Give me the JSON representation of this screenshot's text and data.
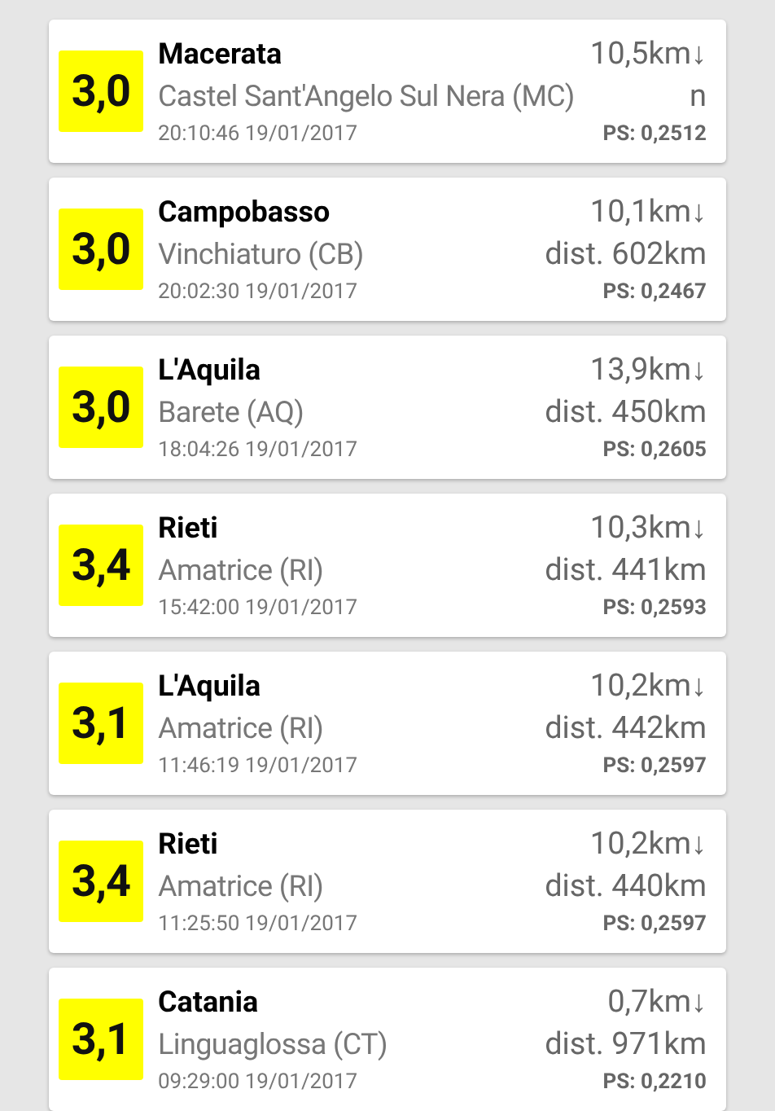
{
  "quakes": [
    {
      "magnitude": "3,0",
      "province": "Macerata",
      "place": "Castel Sant'Angelo Sul Nera (MC)",
      "depth": "10,5km↓",
      "distance": "n",
      "time": "20:10:46 19/01/2017",
      "ps": "PS: 0,2512"
    },
    {
      "magnitude": "3,0",
      "province": "Campobasso",
      "place": "Vinchiaturo (CB)",
      "depth": "10,1km↓",
      "distance": "dist. 602km",
      "time": "20:02:30 19/01/2017",
      "ps": "PS: 0,2467"
    },
    {
      "magnitude": "3,0",
      "province": "L'Aquila",
      "place": "Barete (AQ)",
      "depth": "13,9km↓",
      "distance": "dist. 450km",
      "time": "18:04:26 19/01/2017",
      "ps": "PS: 0,2605"
    },
    {
      "magnitude": "3,4",
      "province": "Rieti",
      "place": "Amatrice (RI)",
      "depth": "10,3km↓",
      "distance": "dist. 441km",
      "time": "15:42:00 19/01/2017",
      "ps": "PS: 0,2593"
    },
    {
      "magnitude": "3,1",
      "province": "L'Aquila",
      "place": "Amatrice (RI)",
      "depth": "10,2km↓",
      "distance": "dist. 442km",
      "time": "11:46:19 19/01/2017",
      "ps": "PS: 0,2597"
    },
    {
      "magnitude": "3,4",
      "province": "Rieti",
      "place": "Amatrice (RI)",
      "depth": "10,2km↓",
      "distance": "dist. 440km",
      "time": "11:25:50 19/01/2017",
      "ps": "PS: 0,2597"
    },
    {
      "magnitude": "3,1",
      "province": "Catania",
      "place": "Linguaglossa (CT)",
      "depth": "0,7km↓",
      "distance": "dist. 971km",
      "time": "09:29:00 19/01/2017",
      "ps": "PS: 0,2210"
    }
  ]
}
